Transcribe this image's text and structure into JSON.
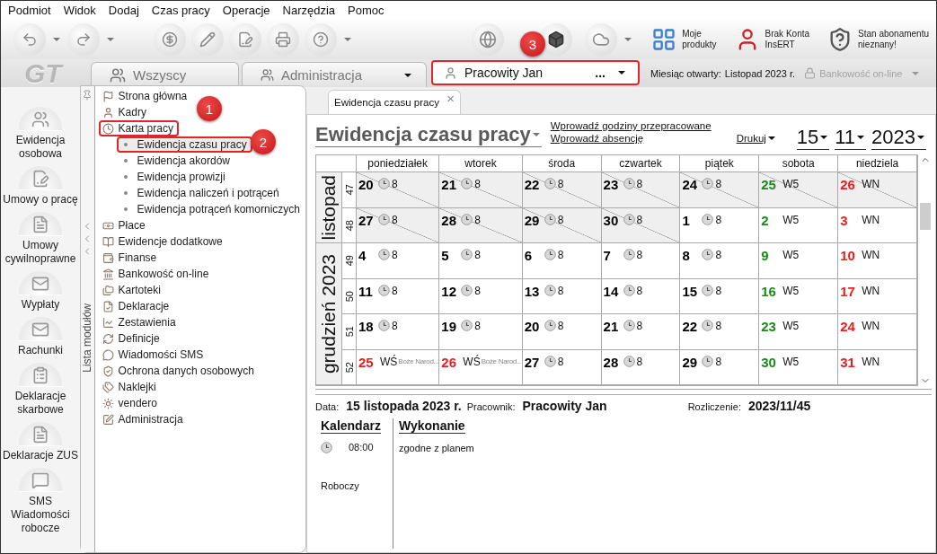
{
  "menu": [
    "Podmiot",
    "Widok",
    "Dodaj",
    "Czas pracy",
    "Operacje",
    "Narzędzia",
    "Pomoc"
  ],
  "toolbar": {
    "products": [
      {
        "lines": [
          "Moje",
          "produkty"
        ]
      },
      {
        "lines": [
          "Brak Konta",
          "InsERT"
        ]
      },
      {
        "lines": [
          "Stan abonamentu",
          "nieznany!"
        ]
      }
    ]
  },
  "logo": "GT",
  "context_bar": {
    "group_tab": "Wszyscy",
    "department": "Administracja",
    "employee": {
      "name": "Pracowity Jan",
      "more": "...",
      "highlighted": true
    },
    "month_label": "Miesiąc otwarty:",
    "month_value": "Listopad 2023 r.",
    "banking": {
      "label": "Bankowość on-line",
      "disabled": true
    }
  },
  "shortcuts": [
    {
      "label": "Ewidencja osobowa"
    },
    {
      "label": "Umowy o pracę"
    },
    {
      "label": "Umowy cywilnoprawne"
    },
    {
      "label": "Wypłaty"
    },
    {
      "label": "Rachunki"
    },
    {
      "label": "Deklaracje skarbowe"
    },
    {
      "label": "Deklaracje ZUS"
    },
    {
      "label": "SMS Wiadomości robocze"
    }
  ],
  "module_panel": {
    "title": "Lista modułów",
    "items": [
      {
        "label": "Strona główna",
        "selected": false,
        "highlighted": false
      },
      {
        "label": "Kadry",
        "selected": false,
        "highlighted": false
      },
      {
        "label": "Karta pracy",
        "selected": false,
        "highlighted": true,
        "children": [
          {
            "label": "Ewidencja czasu pracy",
            "selected": true,
            "highlighted": true
          },
          {
            "label": "Ewidencja akordów",
            "selected": false,
            "highlighted": false
          },
          {
            "label": "Ewidencja prowizji",
            "selected": false,
            "highlighted": false
          },
          {
            "label": "Ewidencja naliczeń i potrąceń",
            "selected": false,
            "highlighted": false
          },
          {
            "label": "Ewidencja potrąceń komorniczych",
            "selected": false,
            "highlighted": false
          }
        ]
      },
      {
        "label": "Płace",
        "selected": false,
        "highlighted": false
      },
      {
        "label": "Ewidencje dodatkowe",
        "selected": false,
        "highlighted": false
      },
      {
        "label": "Finanse",
        "selected": false,
        "highlighted": false
      },
      {
        "label": "Bankowość on-line",
        "selected": false,
        "highlighted": false
      },
      {
        "label": "Kartoteki",
        "selected": false,
        "highlighted": false
      },
      {
        "label": "Deklaracje",
        "selected": false,
        "highlighted": false
      },
      {
        "label": "Zestawienia",
        "selected": false,
        "highlighted": false
      },
      {
        "label": "Definicje",
        "selected": false,
        "highlighted": false
      },
      {
        "label": "Wiadomości SMS",
        "selected": false,
        "highlighted": false
      },
      {
        "label": "Ochrona danych osobowych",
        "selected": false,
        "highlighted": false
      },
      {
        "label": "Naklejki",
        "selected": false,
        "highlighted": false
      },
      {
        "label": "vendero",
        "selected": false,
        "highlighted": false
      },
      {
        "label": "Administracja",
        "selected": false,
        "highlighted": false
      }
    ]
  },
  "document_tab": {
    "label": "Ewidencja czasu pracy",
    "close": "×"
  },
  "view": {
    "title": "Ewidencja czasu pracy",
    "links": [
      "Wprowadź godziny przepracowane",
      "Wprowadź absencję"
    ],
    "print": "Drukuj",
    "date": {
      "day": "15",
      "month": "11",
      "year": "2023"
    }
  },
  "calendar": {
    "weekdays": [
      "poniedziałek",
      "wtorek",
      "środa",
      "czwartek",
      "piątek",
      "sobota",
      "niedziela"
    ],
    "months": [
      {
        "label": "listopad",
        "weeks": [
          {
            "number": "47",
            "days": [
              {
                "day": "20",
                "color": "#000000",
                "kind": "hours",
                "value": "8",
                "hatched": true
              },
              {
                "day": "21",
                "color": "#000000",
                "kind": "hours",
                "value": "8",
                "hatched": true
              },
              {
                "day": "22",
                "color": "#000000",
                "kind": "hours",
                "value": "8",
                "hatched": true
              },
              {
                "day": "23",
                "color": "#000000",
                "kind": "hours",
                "value": "8",
                "hatched": true
              },
              {
                "day": "24",
                "color": "#000000",
                "kind": "hours",
                "value": "8",
                "hatched": true
              },
              {
                "day": "25",
                "color": "#1a8a1a",
                "kind": "code",
                "value": "W5",
                "hatched": true
              },
              {
                "day": "26",
                "color": "#e61e1e",
                "kind": "code",
                "value": "WN",
                "hatched": true
              }
            ]
          },
          {
            "number": "48",
            "days": [
              {
                "day": "27",
                "color": "#000000",
                "kind": "hours",
                "value": "8",
                "hatched": true
              },
              {
                "day": "28",
                "color": "#000000",
                "kind": "hours",
                "value": "8",
                "hatched": true
              },
              {
                "day": "29",
                "color": "#000000",
                "kind": "hours",
                "value": "8",
                "hatched": true
              },
              {
                "day": "30",
                "color": "#000000",
                "kind": "hours",
                "value": "8",
                "hatched": true
              },
              {
                "day": "1",
                "color": "#000000",
                "kind": "hours",
                "value": "8",
                "hatched": false
              },
              {
                "day": "2",
                "color": "#1a8a1a",
                "kind": "code",
                "value": "W5",
                "hatched": false
              },
              {
                "day": "3",
                "color": "#e61e1e",
                "kind": "code",
                "value": "WN",
                "hatched": false
              }
            ]
          }
        ]
      },
      {
        "label": "grudzień 2023",
        "weeks": [
          {
            "number": "49",
            "days": [
              {
                "day": "4",
                "color": "#000000",
                "kind": "hours",
                "value": "8",
                "hatched": false
              },
              {
                "day": "5",
                "color": "#000000",
                "kind": "hours",
                "value": "8",
                "hatched": false
              },
              {
                "day": "6",
                "color": "#000000",
                "kind": "hours",
                "value": "8",
                "hatched": false
              },
              {
                "day": "7",
                "color": "#000000",
                "kind": "hours",
                "value": "8",
                "hatched": false
              },
              {
                "day": "8",
                "color": "#000000",
                "kind": "hours",
                "value": "8",
                "hatched": false
              },
              {
                "day": "9",
                "color": "#1a8a1a",
                "kind": "code",
                "value": "W5",
                "hatched": false
              },
              {
                "day": "10",
                "color": "#e61e1e",
                "kind": "code",
                "value": "WN",
                "hatched": false
              }
            ]
          },
          {
            "number": "50",
            "days": [
              {
                "day": "11",
                "color": "#000000",
                "kind": "hours",
                "value": "8",
                "hatched": false
              },
              {
                "day": "12",
                "color": "#000000",
                "kind": "hours",
                "value": "8",
                "hatched": false
              },
              {
                "day": "13",
                "color": "#000000",
                "kind": "hours",
                "value": "8",
                "hatched": false
              },
              {
                "day": "14",
                "color": "#000000",
                "kind": "hours",
                "value": "8",
                "hatched": false
              },
              {
                "day": "15",
                "color": "#000000",
                "kind": "hours",
                "value": "8",
                "hatched": false
              },
              {
                "day": "16",
                "color": "#1a8a1a",
                "kind": "code",
                "value": "W5",
                "hatched": false
              },
              {
                "day": "17",
                "color": "#e61e1e",
                "kind": "code",
                "value": "WN",
                "hatched": false
              }
            ]
          },
          {
            "number": "51",
            "days": [
              {
                "day": "18",
                "color": "#000000",
                "kind": "hours",
                "value": "8",
                "hatched": false
              },
              {
                "day": "19",
                "color": "#000000",
                "kind": "hours",
                "value": "8",
                "hatched": false
              },
              {
                "day": "20",
                "color": "#000000",
                "kind": "hours",
                "value": "8",
                "hatched": false
              },
              {
                "day": "21",
                "color": "#000000",
                "kind": "hours",
                "value": "8",
                "hatched": false
              },
              {
                "day": "22",
                "color": "#000000",
                "kind": "hours",
                "value": "8",
                "hatched": false
              },
              {
                "day": "23",
                "color": "#1a8a1a",
                "kind": "code",
                "value": "W5",
                "hatched": false
              },
              {
                "day": "24",
                "color": "#e61e1e",
                "kind": "code",
                "value": "WN",
                "hatched": false
              }
            ]
          },
          {
            "number": "52",
            "days": [
              {
                "day": "25",
                "color": "#e61e1e",
                "kind": "code",
                "value": "WŚ",
                "note": "Boże Narod...",
                "hatched": false
              },
              {
                "day": "26",
                "color": "#e61e1e",
                "kind": "code",
                "value": "WŚ",
                "note": "Boże Narod...",
                "hatched": false
              },
              {
                "day": "27",
                "color": "#000000",
                "kind": "hours",
                "value": "8",
                "hatched": false
              },
              {
                "day": "28",
                "color": "#000000",
                "kind": "hours",
                "value": "8",
                "hatched": false
              },
              {
                "day": "29",
                "color": "#000000",
                "kind": "hours",
                "value": "8",
                "hatched": false
              },
              {
                "day": "30",
                "color": "#1a8a1a",
                "kind": "code",
                "value": "W5",
                "hatched": false
              },
              {
                "day": "31",
                "color": "#e61e1e",
                "kind": "code",
                "value": "WN",
                "hatched": false
              }
            ]
          }
        ]
      }
    ]
  },
  "details": {
    "fields": [
      {
        "label": "Data:",
        "value": "15 listopada 2023 r."
      },
      {
        "label": "Pracownik:",
        "value": "Pracowity Jan"
      },
      {
        "label": "Rozliczenie:",
        "value": "2023/11/45"
      }
    ],
    "plan_heading": "Kalendarz",
    "plan_time": "08:00",
    "plan_type": "Roboczy",
    "execution_heading": "Wykonanie",
    "execution_value": "zgodne z planem"
  },
  "annotations": [
    {
      "label": "1"
    },
    {
      "label": "2"
    },
    {
      "label": "3"
    }
  ]
}
